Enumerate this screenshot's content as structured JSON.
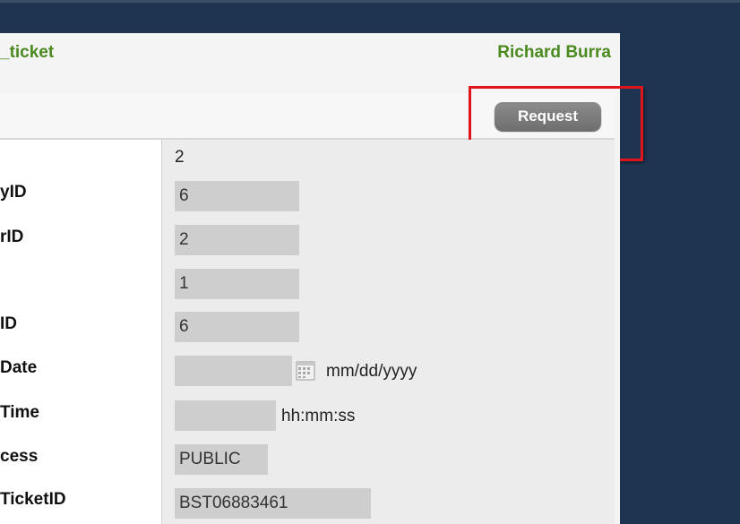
{
  "header": {
    "title": "_ticket",
    "user": "Richard Burra"
  },
  "toolbar": {
    "request_label": "Request"
  },
  "form": {
    "first_value": "2",
    "rows": [
      {
        "label": "yID",
        "value": "6"
      },
      {
        "label": "rID",
        "value": "2"
      },
      {
        "label": "",
        "value": "1"
      },
      {
        "label": "ID",
        "value": "6"
      },
      {
        "label": "Date",
        "value": "",
        "hint": "mm/dd/yyyy"
      },
      {
        "label": "Time",
        "value": "",
        "hint": "hh:mm:ss"
      },
      {
        "label": "cess",
        "value": "PUBLIC"
      },
      {
        "label": "TicketID",
        "value": "BST06883461"
      }
    ]
  },
  "colors": {
    "accent_green": "#4a8a1f",
    "highlight_red": "#e0151b",
    "background_navy": "#1e3450"
  },
  "icons": {
    "date_picker": "calendar-icon"
  }
}
